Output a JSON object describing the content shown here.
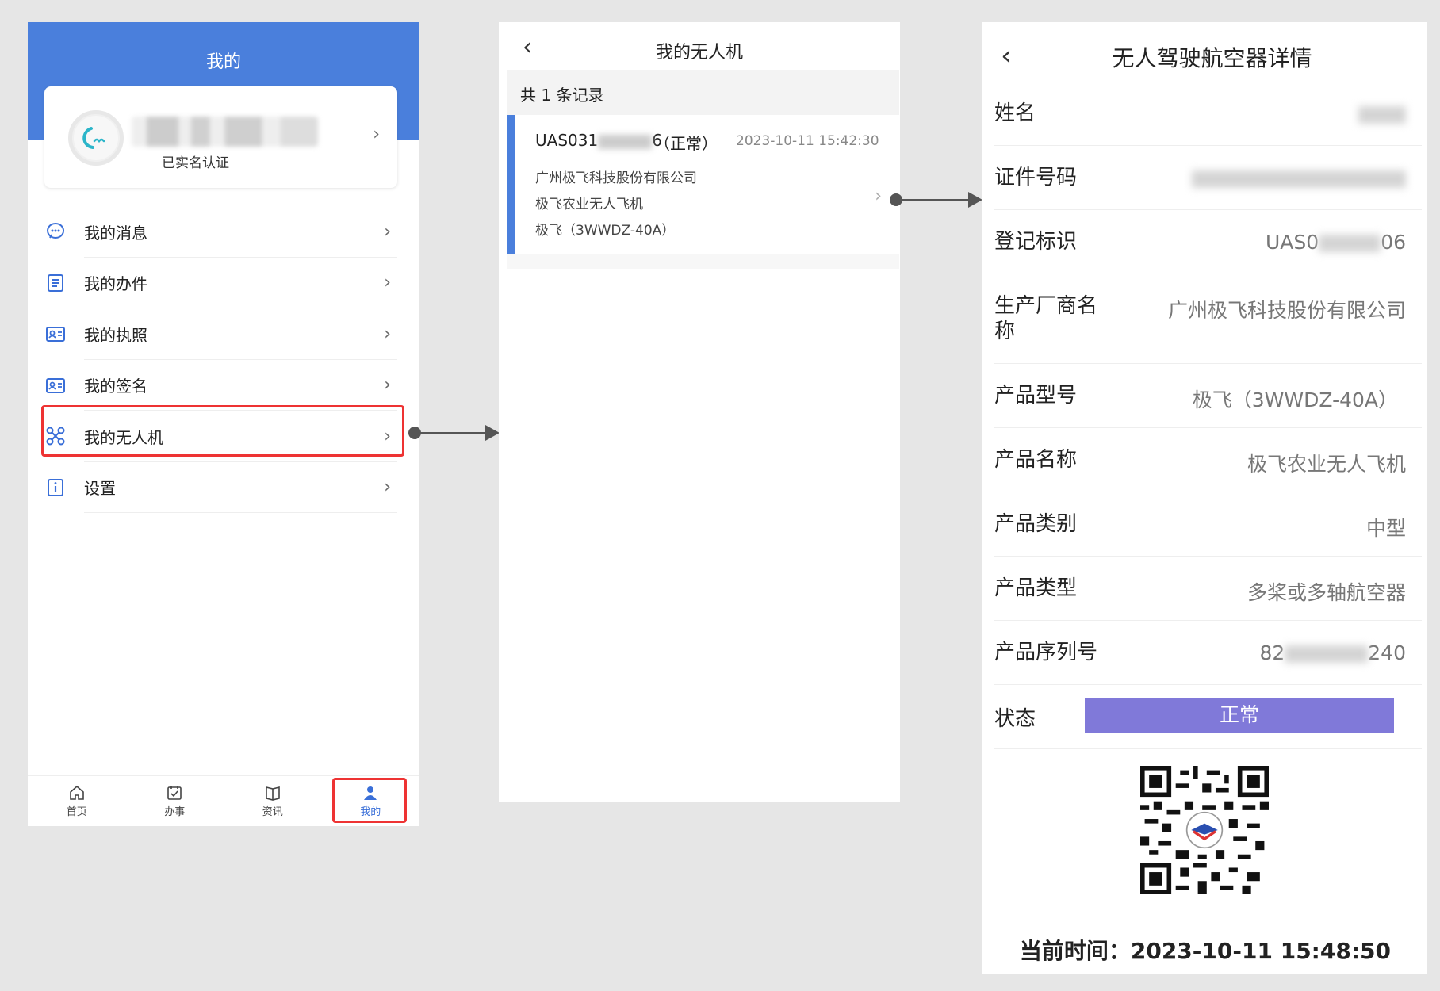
{
  "screen1": {
    "header_title": "我的",
    "profile": {
      "verified_label": "已实名认证"
    },
    "menu": [
      {
        "label": "我的消息",
        "icon": "message-icon"
      },
      {
        "label": "我的办件",
        "icon": "document-icon"
      },
      {
        "label": "我的执照",
        "icon": "license-icon"
      },
      {
        "label": "我的签名",
        "icon": "signature-icon"
      },
      {
        "label": "我的无人机",
        "icon": "drone-icon"
      },
      {
        "label": "设置",
        "icon": "settings-icon"
      }
    ],
    "bottom_nav": [
      {
        "label": "首页",
        "icon": "home-icon"
      },
      {
        "label": "办事",
        "icon": "task-icon"
      },
      {
        "label": "资讯",
        "icon": "news-icon"
      },
      {
        "label": "我的",
        "icon": "user-icon"
      }
    ]
  },
  "screen2": {
    "title": "我的无人机",
    "record_count": "共 1 条记录",
    "record": {
      "id_prefix": "UAS031",
      "id_suffix": "6",
      "status": "（正常）",
      "time": "2023-10-11 15:42:30",
      "manufacturer": "广州极飞科技股份有限公司",
      "product_name": "极飞农业无人飞机",
      "model": "极飞（3WWDZ-40A）"
    }
  },
  "screen3": {
    "title": "无人驾驶航空器详情",
    "fields": {
      "name_label": "姓名",
      "id_number_label": "证件号码",
      "reg_mark_label": "登记标识",
      "reg_mark_prefix": "UAS0",
      "reg_mark_suffix": "06",
      "manufacturer_label": "生产厂商名称",
      "manufacturer": "广州极飞科技股份有限公司",
      "model_label": "产品型号",
      "model": "极飞（3WWDZ-40A）",
      "product_name_label": "产品名称",
      "product_name": "极飞农业无人飞机",
      "category_label": "产品类别",
      "category": "中型",
      "type_label": "产品类型",
      "type": "多桨或多轴航空器",
      "serial_label": "产品序列号",
      "serial_prefix": "82",
      "serial_suffix": "240",
      "status_label": "状态",
      "status": "正常"
    },
    "current_time_label": "当前时间：",
    "current_time": "2023-10-11 15:48:50",
    "colors": {
      "status_bg": "#8079d9",
      "accent": "#4a7fdc",
      "highlight": "#e33333"
    }
  }
}
